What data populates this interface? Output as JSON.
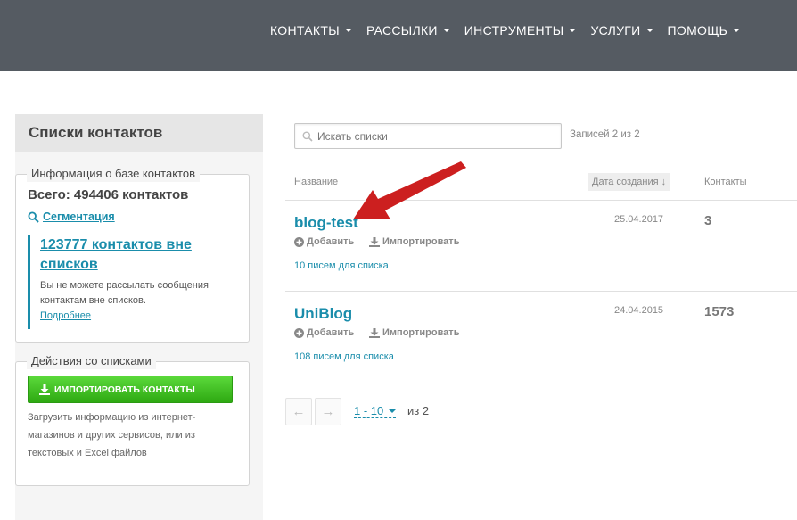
{
  "nav": {
    "items": [
      {
        "label": "КОНТАКТЫ"
      },
      {
        "label": "РАССЫЛКИ"
      },
      {
        "label": "ИНСТРУМЕНТЫ"
      },
      {
        "label": "УСЛУГИ"
      },
      {
        "label": "ПОМОЩЬ"
      }
    ]
  },
  "sidebar": {
    "title": "Списки контактов",
    "info": {
      "legend": "Информация о базе контактов",
      "total": "Всего: 494406 контактов",
      "segmentation": "Сегментация",
      "outside_link": "123777 контактов вне списков",
      "note": "Вы не можете рассылать сообщения контактам вне списков.",
      "more": "Подробнее"
    },
    "actions": {
      "legend": "Действия со списками",
      "import_button": "ИМПОРТИРОВАТЬ КОНТАКТЫ",
      "import_note": "Загрузить информацию из интернет-магазинов и других сервисов, или из текстовых и Excel файлов"
    }
  },
  "main": {
    "search_placeholder": "Искать списки",
    "records": "Записей 2 из 2",
    "columns": {
      "name": "Название",
      "date": "Дата создания ↓",
      "contacts": "Контакты"
    },
    "rows": [
      {
        "name": "blog-test",
        "add": "Добавить",
        "import": "Импортировать",
        "letters": "10 писем для списка",
        "date": "25.04.2017",
        "contacts": "3"
      },
      {
        "name": "UniBlog",
        "add": "Добавить",
        "import": "Импортировать",
        "letters": "108 писем для списка",
        "date": "24.04.2015",
        "contacts": "1573"
      }
    ],
    "pagination": {
      "prev": "←",
      "next": "→",
      "range": "1 - 10",
      "of": "из 2"
    }
  },
  "colors": {
    "topbar": "#555b62",
    "accent": "#1a8dab",
    "button": "#3cbf1e",
    "arrow": "#cc1f1f"
  }
}
